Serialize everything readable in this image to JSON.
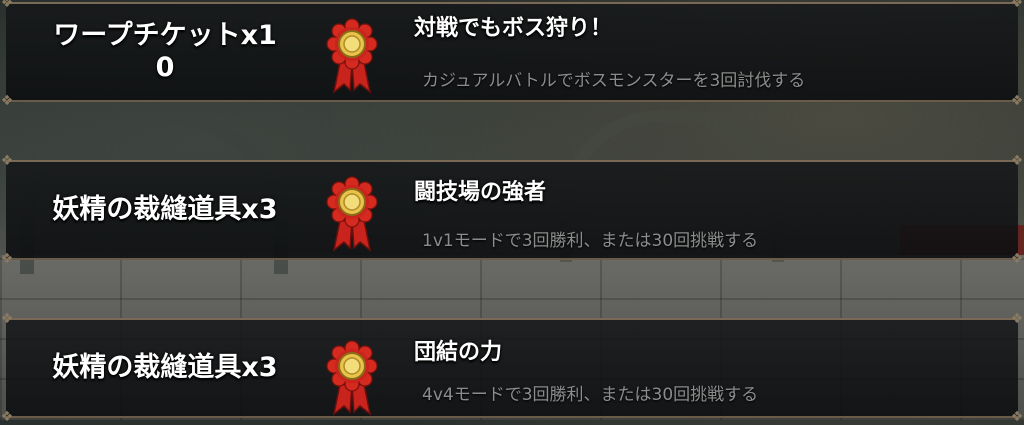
{
  "missions": [
    {
      "reward": "ワープチケットx1\n0",
      "reward_line1": "ワープチケットx1",
      "reward_line2": "0",
      "title": "対戦でもボス狩り！",
      "description": "カジュアルバトルでボスモンスターを3回討伐する",
      "icon": "medal-icon"
    },
    {
      "reward": "妖精の裁縫道具x3",
      "title": "闘技場の強者",
      "description": "1v1モードで3回勝利、または30回挑戦する",
      "icon": "medal-icon"
    },
    {
      "reward": "妖精の裁縫道具x3",
      "title": "団結の力",
      "description": "4v4モードで3回勝利、または30回挑戦する",
      "icon": "medal-icon"
    }
  ],
  "colors": {
    "title": "#ffffff",
    "description": "#8c8c8c",
    "panel_border": "#7a6a55",
    "medal_gold": "#e8c34a",
    "medal_red": "#c8231c"
  }
}
